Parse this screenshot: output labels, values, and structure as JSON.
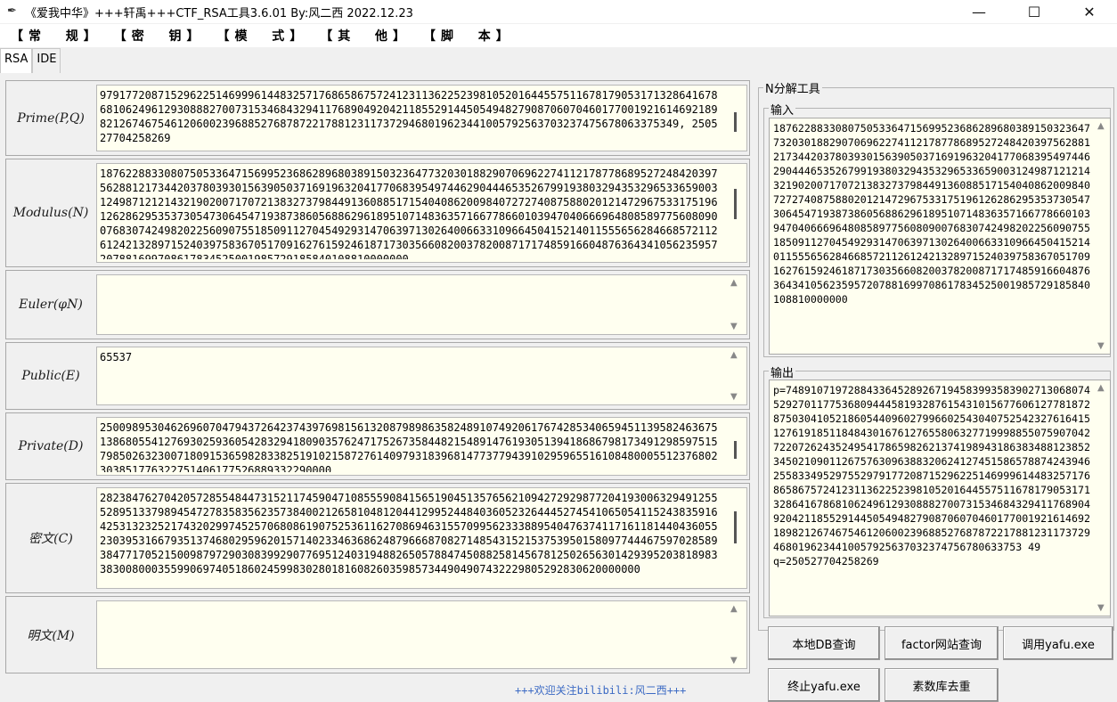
{
  "window": {
    "title": "《爱我中华》+++轩禹+++CTF_RSA工具3.6.01   By:风二西 2022.12.23",
    "minimize": "—",
    "maximize": "☐",
    "close": "✕"
  },
  "menu": [
    "【常  规】",
    "【密  钥】",
    "【模  式】",
    "【其  他】",
    "【脚  本】"
  ],
  "tabs": [
    "RSA",
    "IDE"
  ],
  "fields": {
    "prime": {
      "label": "Prime(P,Q)",
      "value": "979177208715296225146999614483257176865867572412311362252398105201644557511678179053171328641678681062496129308882700731534684329411768904920421185529144505494827908706070460177001921614692189821267467546120600239688527687872217881231173729468019623441005792563703237475678063375349, 250527704258269"
    },
    "modulus": {
      "label": "Modulus(N)",
      "value": "187622883308075053364715699523686289680389150323647732030188290706962274112178778689527248420397562881217344203780393015639050371691963204177068395497446290444653526799193803294353296533659003124987121214321902007170721383273798449136088517154040862009840727274087588020121472967533175196126286295353730547306454719387386056886296189510714836357166778660103947040666964808589775608090076830742498202256090755185091127045492931470639713026400663310966450415214011555656284668572112612421328971524039758367051709162761592461871730356608200378200871717485916604876364341056235957207881699708617834525001985729185840108810000000"
    },
    "euler": {
      "label": "Euler(φN)",
      "value": ""
    },
    "public": {
      "label": "Public(E)",
      "value": "65537"
    },
    "private": {
      "label": "Private(D)",
      "value": "250098953046269607047943726423743976981561320879898635824891074920617674285340659451139582463675138680554127693025936054283294180903576247175267358448215489147619305139418686798173491298597515798502632300718091536598283382519102158727614097931839681477377943910295965516108480005512376802303851776322751406177526889332290000"
    },
    "cipher": {
      "label": "密文(C)",
      "value": "282384762704205728554844731521174590471085559084156519045135765621094272929877204193006329491255528951337989454727835835623573840021265810481204412995244840360523264445274541065054115243835916425313232521743202997452570680861907525361162708694631557099562333889540476374117161181440436055230395316679351374680295962015714023346368624879666870827148543152153753950158097744467597028589384771705215009879729030839929077695124031948826505788474508825814567812502656301429395203818983383008000355990697405186024599830280181608260359857344904907432229805292830620000000"
    },
    "plain": {
      "label": "明文(M)",
      "value": ""
    }
  },
  "footer": "+++欢迎关注bilibili:风二西+++",
  "nfactor": {
    "title": "N分解工具",
    "input_label": "输入",
    "input_value": "187622883308075053364715699523686289680389150323647732030188290706962274112178778689527248420397562881217344203780393015639050371691963204177068395497446290444653526799193803294353296533659003124987121214321902007170721383273798449136088517154040862009840727274087588020121472967533175196126286295353730547306454719387386056886296189510714836357166778660103947040666964808589775608090076830742498202256090755185091127045492931470639713026400663310966450415214011555656284668572112612421328971524039758367051709162761592461871730356608200378200871717485916604876364341056235957207881699708617834525001985729185840108810000000",
    "output_label": "输出",
    "output_value": "p=74891071972884336452892671945839935839027130680745292701177536809444581932876154310156776061277818728750304105218605440960279966025430407525423276164151276191851184843016761276558063277199988550759070427220726243524954178659826213741989431863834881238523450210901126757630963883206241274515865788742439462558334952975529791772087152962251469996144832571768658675724123113622523981052016445575116781790531713286416786810624961293088827007315346843294117689049204211855291445054948279087060704601770019216146921898212674675461206002396885276878722178812311737294680196234410057925637032374756780633753 49",
    "output_q": "q=250527704258269"
  },
  "buttons": {
    "local_db": "本地DB查询",
    "factor_site": "factor网站查询",
    "call_yafu": "调用yafu.exe",
    "stop_yafu": "终止yafu.exe",
    "prime_dedup": "素数库去重"
  }
}
